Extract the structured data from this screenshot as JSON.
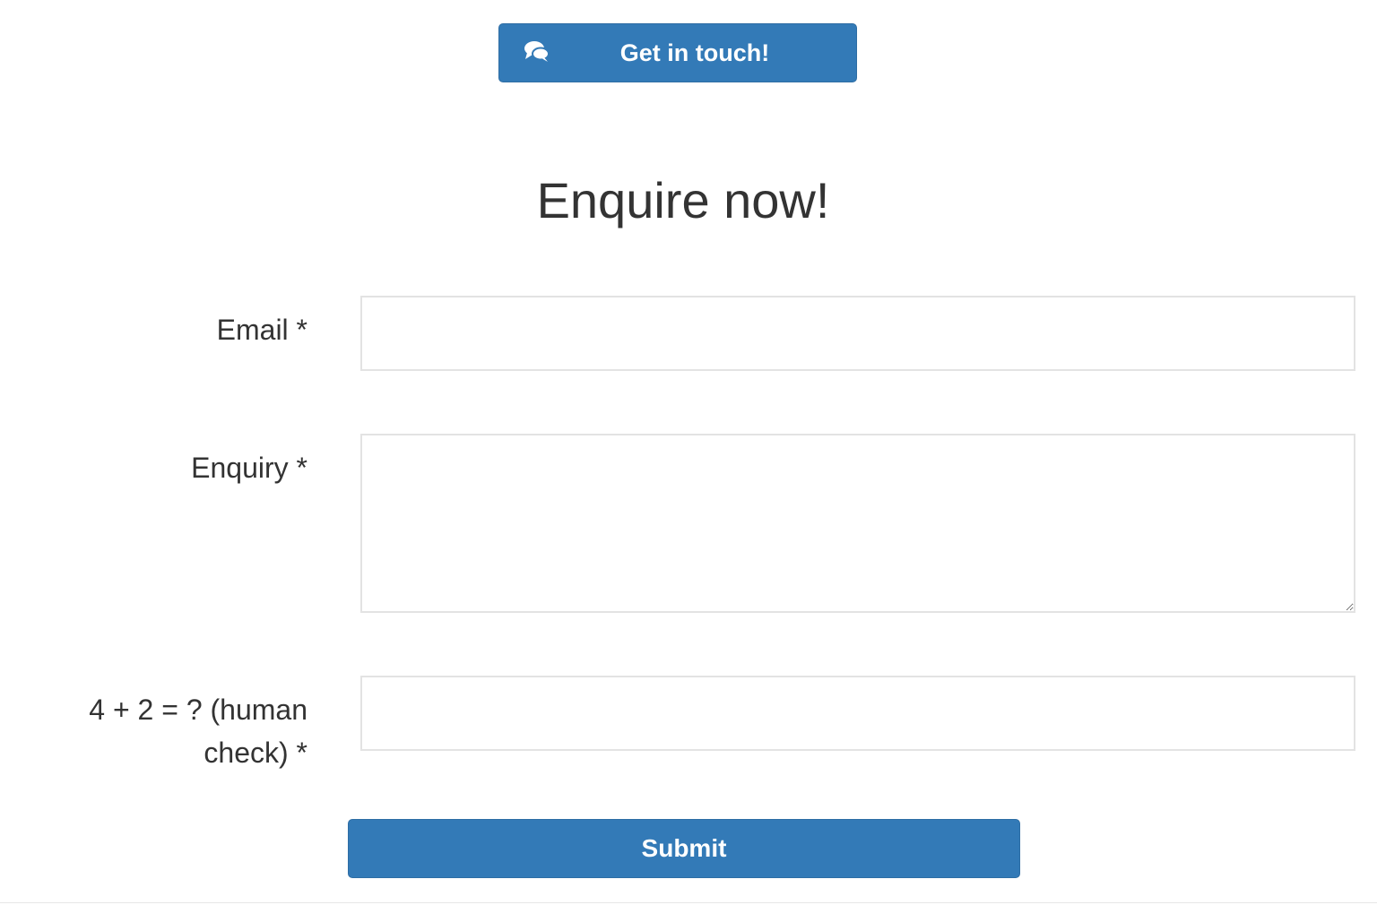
{
  "header": {
    "touch_button_label": "Get in touch!",
    "touch_button_icon": "comments-icon"
  },
  "form": {
    "heading": "Enquire now!",
    "email": {
      "label": "Email *",
      "value": "",
      "placeholder": ""
    },
    "enquiry": {
      "label": "Enquiry *",
      "value": "",
      "placeholder": ""
    },
    "human_check": {
      "label": "4 + 2 = ? (human check) *",
      "value": "",
      "placeholder": ""
    },
    "submit_label": "Submit"
  },
  "colors": {
    "accent": "#337ab7",
    "accent_border": "#2e6da4",
    "text": "#333333",
    "input_border": "#e3e3e3"
  }
}
